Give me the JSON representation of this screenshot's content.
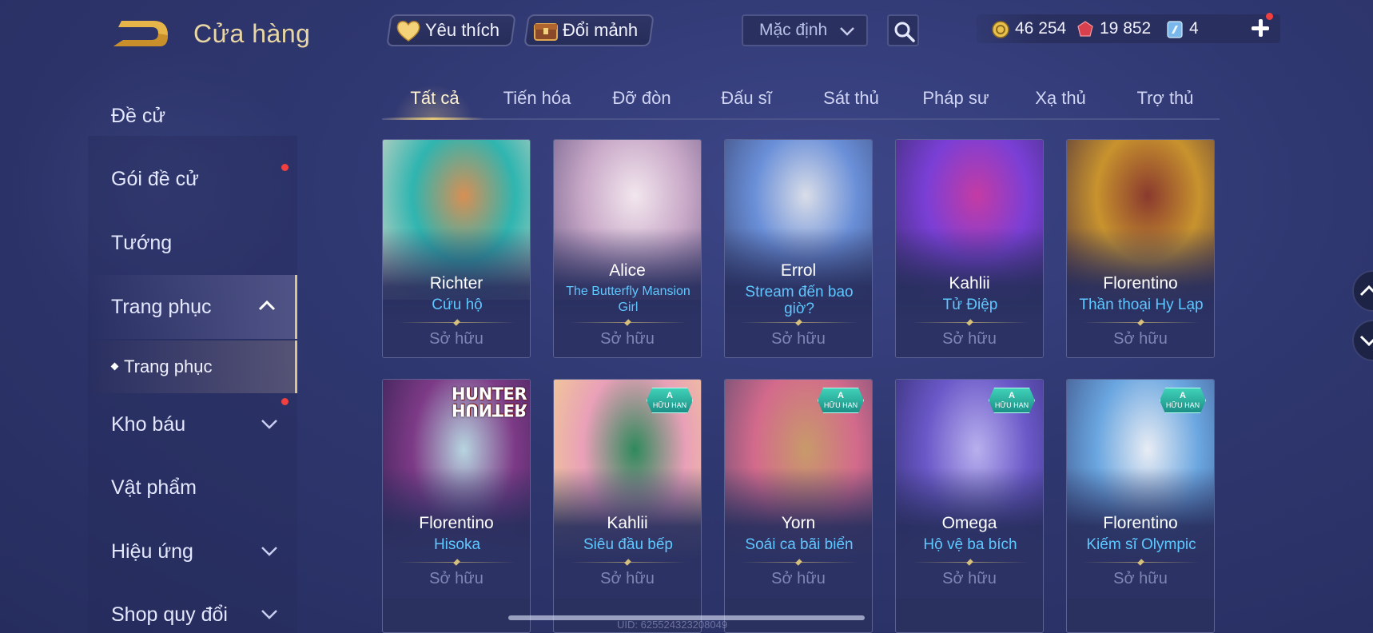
{
  "header": {
    "title": "Cửa hàng",
    "favorite_label": "Yêu thích",
    "exchange_label": "Đổi mảnh",
    "sort_value": "Mặc định"
  },
  "currency": {
    "gold": "46 254",
    "ruby": "19 852",
    "voucher": "4"
  },
  "sidebar": {
    "items": [
      {
        "label": "Đề cử",
        "expandable": false,
        "notify": false
      },
      {
        "label": "Gói đề cử",
        "expandable": false,
        "notify": true
      },
      {
        "label": "Tướng",
        "expandable": false,
        "notify": false
      },
      {
        "label": "Trang phục",
        "expandable": true,
        "notify": false,
        "active": true
      },
      {
        "label": "Trang phục",
        "sub": true
      },
      {
        "label": "Kho báu",
        "expandable": true,
        "notify": true
      },
      {
        "label": "Vật phẩm",
        "expandable": false,
        "notify": false
      },
      {
        "label": "Hiệu ứng",
        "expandable": true,
        "notify": false
      },
      {
        "label": "Shop quy đổi",
        "expandable": true,
        "notify": false
      }
    ]
  },
  "tabs": [
    {
      "label": "Tất cả",
      "active": true
    },
    {
      "label": "Tiến hóa"
    },
    {
      "label": "Đỡ đòn"
    },
    {
      "label": "Đấu sĩ"
    },
    {
      "label": "Sát thủ"
    },
    {
      "label": "Pháp sư"
    },
    {
      "label": "Xạ thủ"
    },
    {
      "label": "Trợ thủ"
    }
  ],
  "cards": [
    {
      "hero": "Richter",
      "skin": "Cứu hộ",
      "status": "Sở hữu",
      "badge": false,
      "palette": [
        "#2fb5b0",
        "#d88f54",
        "#e8d8c8"
      ]
    },
    {
      "hero": "Alice",
      "skin": "The Butterfly Mansion Girl",
      "status": "Sở hữu",
      "badge": false,
      "palette": [
        "#c9a9c8",
        "#f2e6ee",
        "#6b5a86"
      ]
    },
    {
      "hero": "Errol",
      "skin": "Stream đến bao giờ?",
      "status": "Sở hữu",
      "badge": false,
      "palette": [
        "#6a8fd8",
        "#d9dde8",
        "#3a4776"
      ]
    },
    {
      "hero": "Kahlii",
      "skin": "Tử Điệp",
      "status": "Sở hữu",
      "badge": false,
      "palette": [
        "#7a3fd6",
        "#c43ba4",
        "#3a2d6e"
      ]
    },
    {
      "hero": "Florentino",
      "skin": "Thần thoại Hy Lạp",
      "status": "Sở hữu",
      "badge": false,
      "palette": [
        "#c8932e",
        "#8a3a2e",
        "#4a2e3e"
      ]
    },
    {
      "hero": "Florentino",
      "skin": "Hisoka",
      "status": "Sở hữu",
      "badge": false,
      "logo": "HUNTER",
      "palette": [
        "#7d3a86",
        "#b7d5e0",
        "#2e1e4e"
      ]
    },
    {
      "hero": "Kahlii",
      "skin": "Siêu đầu bếp",
      "status": "Sở hữu",
      "badge": true,
      "palette": [
        "#e9a0b8",
        "#2f8a5c",
        "#f4d88a"
      ]
    },
    {
      "hero": "Yorn",
      "skin": "Soái ca bãi biển",
      "status": "Sở hữu",
      "badge": true,
      "palette": [
        "#d36a8c",
        "#c89a6a",
        "#5a4a6e"
      ]
    },
    {
      "hero": "Omega",
      "skin": "Hộ vệ ba bích",
      "status": "Sở hữu",
      "badge": true,
      "palette": [
        "#6a58c8",
        "#b8b0ee",
        "#2e2a6a"
      ]
    },
    {
      "hero": "Florentino",
      "skin": "Kiếm sĩ Olympic",
      "status": "Sở hữu",
      "badge": true,
      "palette": [
        "#6aa6e0",
        "#e8ecf4",
        "#3a4a7e"
      ]
    }
  ],
  "badge": {
    "grade": "A",
    "text": "HỮU HẠN"
  },
  "footer": {
    "uid": "UID: 625524323208049"
  }
}
